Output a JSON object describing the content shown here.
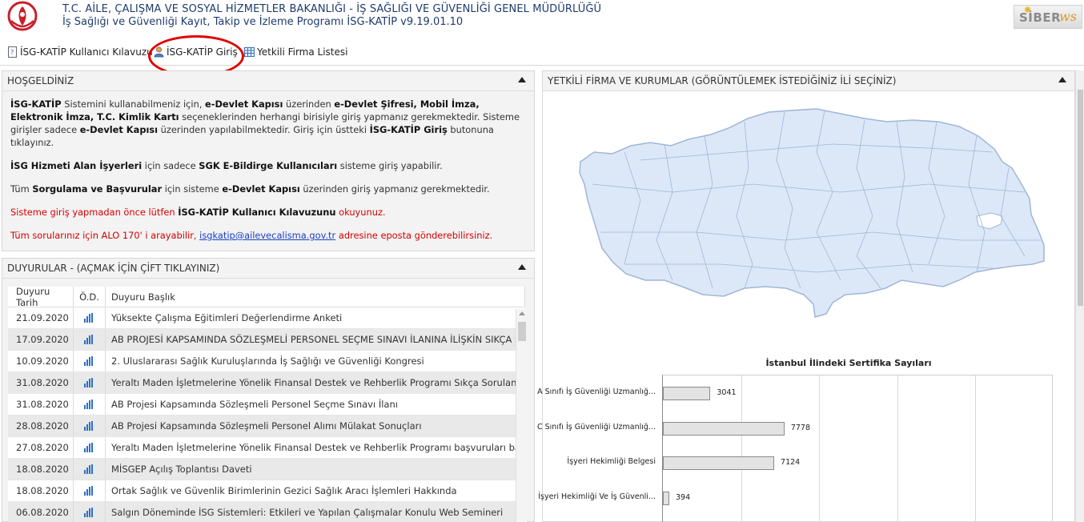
{
  "header": {
    "line1": "T.C. AİLE, ÇALIŞMA VE SOSYAL HİZMETLER BAKANLIĞI - İŞ SAĞLIĞI VE GÜVENLİĞİ GENEL MÜDÜRLÜĞÜ",
    "line2": "İş Sağlığı ve Güvenliği Kayıt, Takip ve İzleme Programı İSG-KATİP v9.19.01.10",
    "brand_text": "SİBER",
    "brand_ws": "ws"
  },
  "toolbar": {
    "guide_label": "İSG-KATİP Kullanıcı Kılavuzu",
    "login_label": "İSG-KATİP Giriş",
    "firms_label": "Yetkili Firma Listesi"
  },
  "welcome": {
    "title": "HOŞGELDİNİZ",
    "p1_a": "İSG-KATİP",
    "p1_b": " Sistemini kullanabilmeniz için, ",
    "p1_c": "e-Devlet Kapısı",
    "p1_d": " üzerinden ",
    "p1_e": "e-Devlet Şifresi, Mobil İmza, Elektronik İmza, T.C. Kimlik Kartı",
    "p1_f": " seçeneklerinden herhangi birisiyle giriş yapmanız gerekmektedir. Sisteme girişler sadece ",
    "p1_g": "e-Devlet Kapısı",
    "p1_h": " üzerinden yapılabilmektedir. Giriş için üstteki ",
    "p1_i": "İSG-KATİP Giriş",
    "p1_j": " butonuna tıklayınız.",
    "p2_a": "İSG Hizmeti Alan İşyerleri",
    "p2_b": " için sadece ",
    "p2_c": "SGK E-Bildirge Kullanıcıları",
    "p2_d": " sisteme giriş yapabilir.",
    "p3_a": "Tüm ",
    "p3_b": "Sorgulama ve Başvurular",
    "p3_c": " için sisteme ",
    "p3_d": "e-Devlet Kapısı",
    "p3_e": " üzerinden giriş yapmanız gerekmektedir.",
    "p4_a": "Sisteme giriş yapmadan önce lütfen ",
    "p4_b": "İSG-KATİP Kullanıcı Kılavuzunu",
    "p4_c": " okuyunuz.",
    "p5_a": "Tüm sorularınız için ALO 170' i arayabilir, ",
    "p5_link": "isgkatip@ailevecalisma.gov.tr",
    "p5_c": " adresine eposta gönderebilirsiniz."
  },
  "announcements": {
    "title": "DUYURULAR - (AÇMAK İÇİN ÇİFT TIKLAYINIZ)",
    "columns": [
      "Duyuru Tarih",
      "Ö.D.",
      "Duyuru Başlık"
    ],
    "rows": [
      {
        "date": "21.09.2020",
        "title": "Yüksekte Çalışma Eğitimleri Değerlendirme Anketi"
      },
      {
        "date": "17.09.2020",
        "title": "AB PROJESİ KAPSAMINDA SÖZLEŞMELİ PERSONEL SEÇME SINAVI İLANINA İLİŞKİN SIKÇA SORULAN SORULAR"
      },
      {
        "date": "10.09.2020",
        "title": "2. Uluslararası Sağlık Kuruluşlarında İş Sağlığı ve Güvenliği Kongresi"
      },
      {
        "date": "31.08.2020",
        "title": "Yeraltı Maden İşletmelerine Yönelik Finansal Destek ve Rehberlik Programı Sıkça Sorulan Sorular"
      },
      {
        "date": "31.08.2020",
        "title": "AB Projesi Kapsamında Sözleşmeli Personel Seçme Sınavı İlanı"
      },
      {
        "date": "28.08.2020",
        "title": "AB Projesi Kapsamında Sözleşmeli Personel Alımı Mülakat Sonuçları"
      },
      {
        "date": "27.08.2020",
        "title": "Yeraltı Maden İşletmelerine Yönelik Finansal Destek ve Rehberlik Programı başvuruları başlamıştır"
      },
      {
        "date": "18.08.2020",
        "title": "MİSGEP Açılış Toplantısı Daveti"
      },
      {
        "date": "18.08.2020",
        "title": "Ortak Sağlık ve Güvenlik Birimlerinin Gezici Sağlık Aracı İşlemleri Hakkında"
      },
      {
        "date": "06.08.2020",
        "title": "Salgın Döneminde İSG Sistemleri: Etkileri ve Yapılan Çalışmalar Konulu Web Semineri"
      }
    ]
  },
  "map_panel": {
    "title": "YETKİLİ FİRMA VE KURUMLAR (GÖRÜNTÜLEMEK İSTEDİĞİNİZ İLİ SEÇİNİZ)",
    "map_fill": "#dce8f8",
    "map_stroke": "#9fb6d6"
  },
  "chart_data": {
    "type": "bar",
    "orientation": "horizontal",
    "title": "İstanbul İlindeki Sertifika Sayıları",
    "categories": [
      "A Sınıfı İş Güvenliği Uzmanlığ...",
      "C Sınıfı İş Güvenliği Uzmanlığ...",
      "İşyeri Hekimliği Belgesi",
      "İşyeri Hekimliği Ve İş Güvenli..."
    ],
    "values": [
      3041,
      7778,
      7124,
      394
    ],
    "xlim": [
      0,
      25000
    ],
    "grid": true
  }
}
